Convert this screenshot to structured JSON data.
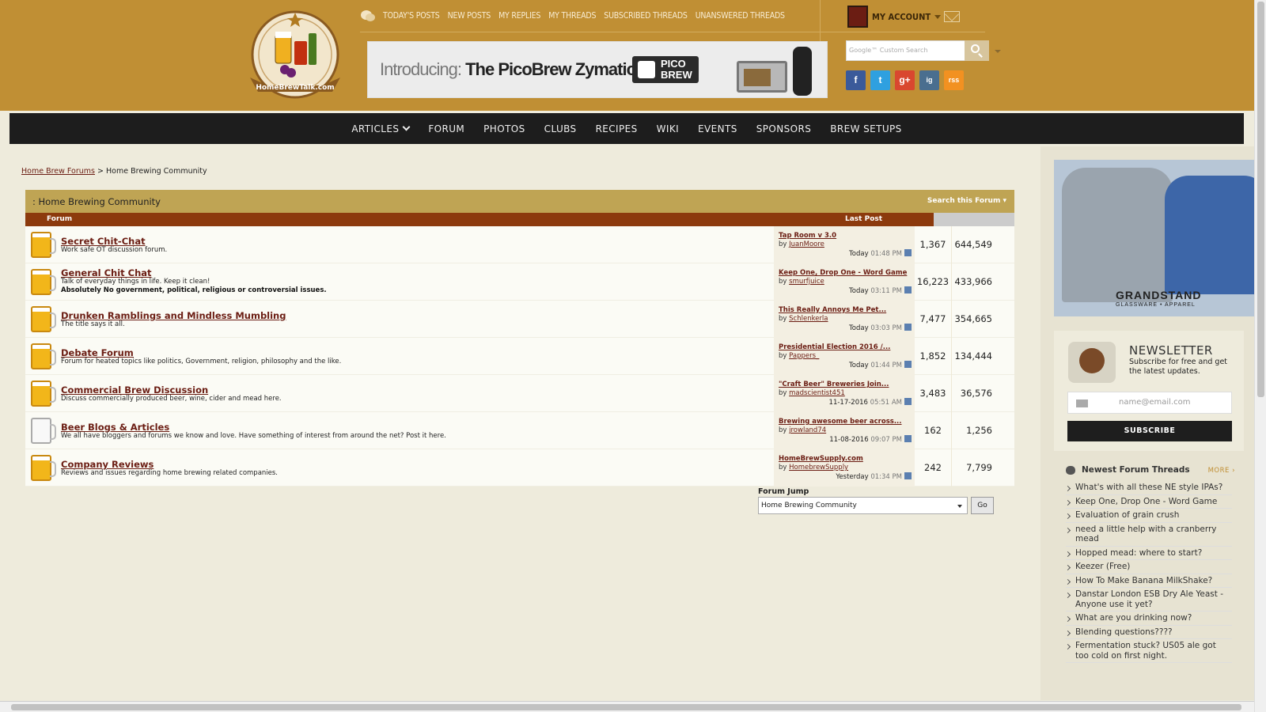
{
  "header": {
    "top_links": [
      "TODAY'S POSTS",
      "NEW POSTS",
      "MY REPLIES",
      "MY THREADS",
      "SUBSCRIBED THREADS",
      "UNANSWERED THREADS"
    ],
    "account_label": "MY ACCOUNT",
    "search_placeholder": "Google™ Custom Search",
    "banner": {
      "intro": "Introducing:",
      "product": "The PicoBrew Zymatic",
      "reg": "®",
      "badge": "PICO BREW"
    },
    "social": [
      "f",
      "t",
      "g+",
      "ig",
      "rss"
    ]
  },
  "main_nav": [
    "ARTICLES",
    "FORUM",
    "PHOTOS",
    "CLUBS",
    "RECIPES",
    "WIKI",
    "EVENTS",
    "SPONSORS",
    "BREW SETUPS"
  ],
  "breadcrumb": {
    "root": "Home Brew Forums",
    "sep": ">",
    "current": "Home Brewing Community"
  },
  "forum_box": {
    "title": ": Home Brewing Community",
    "search_link": "Search this Forum",
    "col_forum": "Forum",
    "col_last_post": "Last Post",
    "rows": [
      {
        "title": "Secret Chit-Chat",
        "desc": "Work safe OT discussion forum.",
        "desc2": "",
        "lp_title": "Tap Room v 3.0",
        "lp_by": "JuanMoore",
        "lp_date": "Today",
        "lp_time": "01:48 PM",
        "threads": "1,367",
        "posts": "644,549",
        "icon": "full"
      },
      {
        "title": "General Chit Chat",
        "desc": "Talk of everyday things in life. Keep it clean!",
        "desc2": "Absolutely No government, political, religious or controversial issues.",
        "lp_title": "Keep One, Drop One - Word Game",
        "lp_by": "smurfjuice",
        "lp_date": "Today",
        "lp_time": "03:11 PM",
        "threads": "16,223",
        "posts": "433,966",
        "icon": "full"
      },
      {
        "title": "Drunken Ramblings and Mindless Mumbling",
        "desc": "The title says it all.",
        "desc2": "",
        "lp_title": "This Really Annoys Me Pet...",
        "lp_by": "Schlenkerla",
        "lp_date": "Today",
        "lp_time": "03:03 PM",
        "threads": "7,477",
        "posts": "354,665",
        "icon": "full"
      },
      {
        "title": "Debate Forum",
        "desc": "Forum for heated topics like politics, Government, religion, philosophy and the like.",
        "desc2": "",
        "lp_title": "Presidential Election 2016 /...",
        "lp_by": "Pappers_",
        "lp_date": "Today",
        "lp_time": "01:44 PM",
        "threads": "1,852",
        "posts": "134,444",
        "icon": "full"
      },
      {
        "title": "Commercial Brew Discussion",
        "desc": "Discuss commercially produced beer, wine, cider and mead here.",
        "desc2": "",
        "lp_title": "\"Craft Beer\" Breweries Join...",
        "lp_by": "madscientist451",
        "lp_date": "11-17-2016",
        "lp_time": "05:51 AM",
        "threads": "3,483",
        "posts": "36,576",
        "icon": "full"
      },
      {
        "title": "Beer Blogs & Articles",
        "desc": "We all have bloggers and forums we know and love. Have something of interest from around the net? Post it here.",
        "desc2": "",
        "lp_title": "Brewing awesome beer across...",
        "lp_by": "jrowland74",
        "lp_date": "11-08-2016",
        "lp_time": "09:07 PM",
        "threads": "162",
        "posts": "1,256",
        "icon": "empty"
      },
      {
        "title": "Company Reviews",
        "desc": "Reviews and issues regarding home brewing related companies.",
        "desc2": "",
        "lp_title": "HomeBrewSupply.com",
        "lp_by": "HomebrewSupply",
        "lp_date": "Yesterday",
        "lp_time": "01:34 PM",
        "threads": "242",
        "posts": "7,799",
        "icon": "full"
      }
    ]
  },
  "forum_jump": {
    "label": "Forum Jump",
    "selected": "Home Brewing Community",
    "go": "Go"
  },
  "sidebar": {
    "ad": {
      "brand": "GRANDSTAND",
      "tagline": "GLASSWARE • APPAREL"
    },
    "newsletter": {
      "title": "NEWSLETTER",
      "subtitle": "Subscribe for free and get the latest updates.",
      "email_placeholder": "name@email.com",
      "button": "SUBSCRIBE"
    },
    "threads_title": "Newest Forum Threads",
    "more": "MORE",
    "threads": [
      "What's with all these NE style IPAs?",
      "Keep One, Drop One - Word Game",
      "Evaluation of grain crush",
      "need a little help with a cranberry mead",
      "Hopped mead: where to start?",
      "Keezer (Free)",
      "How To Make Banana MilkShake?",
      "Danstar London ESB Dry Ale Yeast - Anyone use it yet?",
      "What are you drinking now?",
      "Blending questions????",
      "Fermentation stuck? US05 ale got too cold on first night."
    ]
  },
  "colors": {
    "header_bg": "#c08f34",
    "nav_bg": "#1d1d1d",
    "forum_head": "#bfa454",
    "col_head": "#8c3a0d",
    "link": "#6b1d13"
  }
}
